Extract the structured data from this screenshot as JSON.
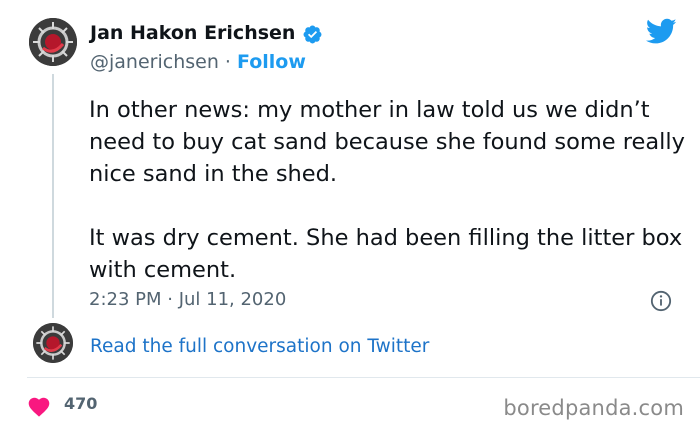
{
  "author": {
    "name": "Jan Hakon Erichsen",
    "handle": "@janerichsen",
    "separator": "·",
    "follow_label": "Follow",
    "verified": true
  },
  "tweet": {
    "paragraphs": [
      "In other news: my mother in law told us we didn’t need to buy cat sand because she found some really nice sand in the shed.",
      "It was dry cement. She had been filling the litter box with cement."
    ],
    "timestamp": "2:23 PM · Jul 11, 2020"
  },
  "footer": {
    "conversation_link": "Read the full conversation on Twitter",
    "like_count": "470"
  },
  "watermark": "boredpanda.com",
  "icons": {
    "brand": "twitter-bird-icon",
    "verified": "verified-badge-icon",
    "info": "info-icon",
    "like": "heart-icon"
  },
  "colors": {
    "accent": "#1d9bf0",
    "link": "#1d73c8",
    "heart": "#f91880",
    "muted": "#536471",
    "text": "#0f1419"
  }
}
